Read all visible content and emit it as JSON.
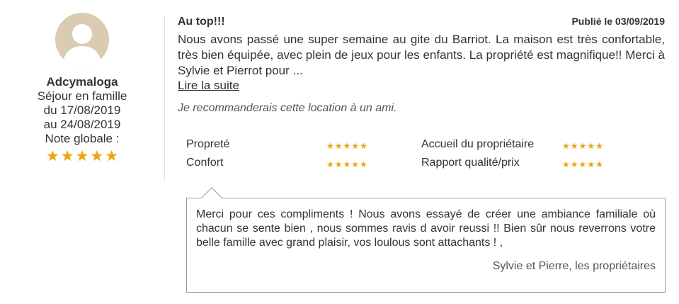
{
  "reviewer": {
    "name": "Adcymaloga",
    "stay_type": "Séjour en famille",
    "date_from": "du 17/08/2019",
    "date_to": "au 24/08/2019",
    "overall_label": "Note globale :",
    "overall_stars": 5,
    "star_color": "#f5a300"
  },
  "review": {
    "title": "Au top!!!",
    "published": "Publié le 03/09/2019",
    "text": "Nous avons passé une super semaine au gite du Barriot. La maison est très confortable, très bien équipée, avec plein de jeux pour les enfants. La propriété est magnifique!! Merci à Sylvie et Pierrot pour ...",
    "read_more": "Lire la suite",
    "recommend": "Je recommanderais cette location à un ami."
  },
  "ratings": [
    {
      "label": "Propreté",
      "stars": 5
    },
    {
      "label": "Accueil du propriétaire",
      "stars": 5
    },
    {
      "label": "Confort",
      "stars": 5
    },
    {
      "label": "Rapport qualité/prix",
      "stars": 5
    }
  ],
  "owner_reply": {
    "text": "Merci pour ces compliments ! Nous avons essayé de créer une ambiance familiale où chacun se sente bien , nous sommes ravis d avoir reussi !! Bien sûr nous reverrons votre belle famille avec grand plaisir, vos loulous sont attachants ! ,",
    "signature": "Sylvie et Pierre, les propriétaires"
  }
}
